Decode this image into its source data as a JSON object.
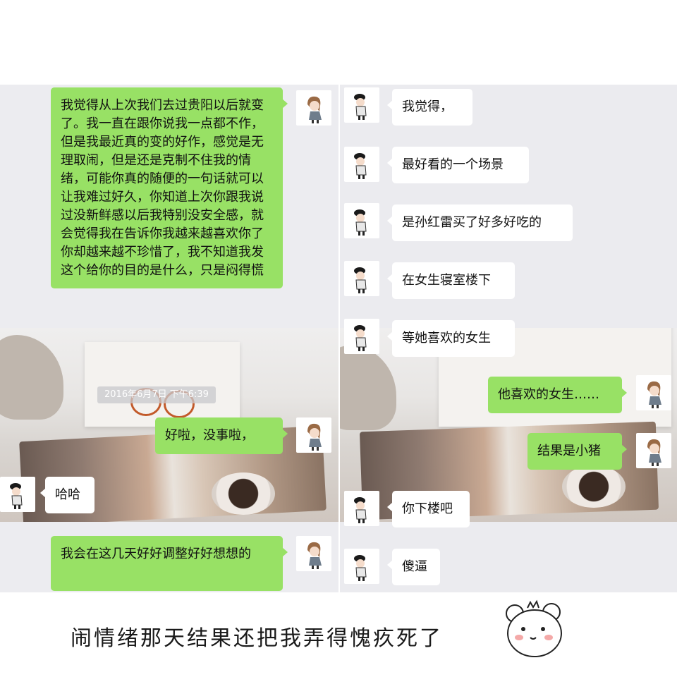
{
  "timestamp": "2016年6月7日 下午6:39",
  "left_chat": [
    {
      "side": "me",
      "text": "我觉得从上次我们去过贵阳以后就变了。我一直在跟你说我一点都不作，但是我最近真的变的好作，感觉是无理取闹，但是还是克制不住我的情绪，可能你真的随便的一句话就可以让我难过好久，你知道上次你跟我说过没新鲜感以后我特别没安全感，就会觉得我在告诉你我越来越喜欢你了你却越来越不珍惜了，我不知道我发这个给你的目的是什么，只是闷得慌"
    },
    {
      "side": "me",
      "text": "好啦，没事啦，"
    },
    {
      "side": "other",
      "text": "哈哈"
    },
    {
      "side": "me",
      "text": "我会在这几天好好调整好好想想的"
    }
  ],
  "right_chat": [
    {
      "side": "other",
      "text": "我觉得，"
    },
    {
      "side": "other",
      "text": "最好看的一个场景"
    },
    {
      "side": "other",
      "text": "是孙红雷买了好多好吃的"
    },
    {
      "side": "other",
      "text": "在女生寝室楼下"
    },
    {
      "side": "other",
      "text": "等她喜欢的女生"
    },
    {
      "side": "me",
      "text": "他喜欢的女生……"
    },
    {
      "side": "me",
      "text": "结果是小猪"
    },
    {
      "side": "other",
      "text": "你下楼吧"
    },
    {
      "side": "other",
      "text": "傻逼"
    }
  ],
  "caption": "闹情绪那天结果还把我弄得愧疚死了",
  "colors": {
    "me_bubble": "#98e165",
    "other_bubble": "#ffffff",
    "panel_bg": "#ececf0"
  },
  "icons": {
    "me_avatar": "girl-avatar-icon",
    "other_avatar": "boy-avatar-icon",
    "sticker": "hamster-sticker-icon"
  }
}
